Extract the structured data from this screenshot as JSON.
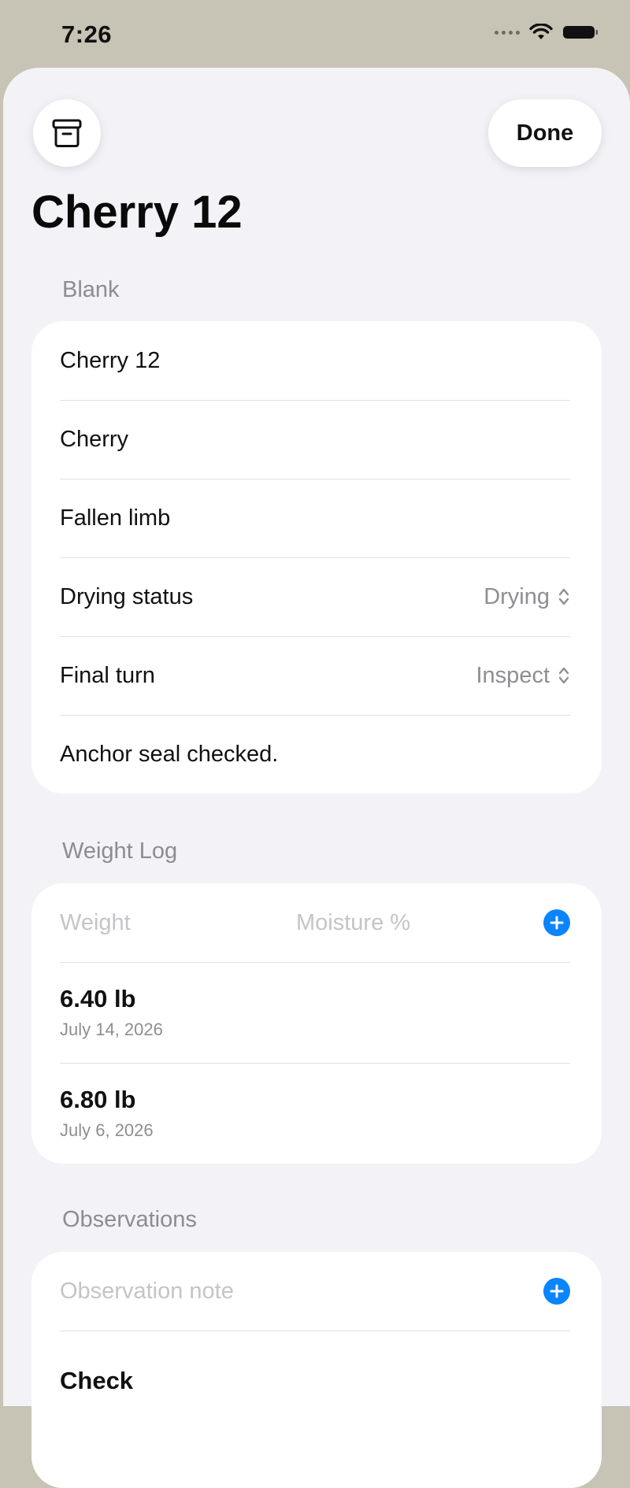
{
  "status_bar": {
    "time": "7:26",
    "icons": [
      "signal-icon",
      "wifi-icon",
      "battery-icon"
    ]
  },
  "toolbar": {
    "archive_icon": "archive-box-icon",
    "done_label": "Done"
  },
  "title": "Cherry 12",
  "blank_section": {
    "header": "Blank",
    "rows": [
      {
        "label": "Cherry 12"
      },
      {
        "label": "Cherry"
      },
      {
        "label": "Fallen limb"
      },
      {
        "label": "Drying status",
        "value": "Drying"
      },
      {
        "label": "Final turn",
        "value": "Inspect"
      },
      {
        "label": "Anchor seal checked."
      }
    ]
  },
  "weight_log": {
    "header": "Weight Log",
    "weight_placeholder": "Weight",
    "moisture_placeholder": "Moisture %",
    "entries": [
      {
        "weight": "6.40 lb",
        "date": "July 14, 2026"
      },
      {
        "weight": "6.80 lb",
        "date": "July 6, 2026"
      }
    ]
  },
  "observations": {
    "header": "Observations",
    "note_placeholder": "Observation note",
    "first_entry_partial": "Check"
  },
  "colors": {
    "accent": "#0a84ff",
    "background": "#f2f2f7",
    "card": "#ffffff",
    "secondary_text": "#8e8e93"
  }
}
